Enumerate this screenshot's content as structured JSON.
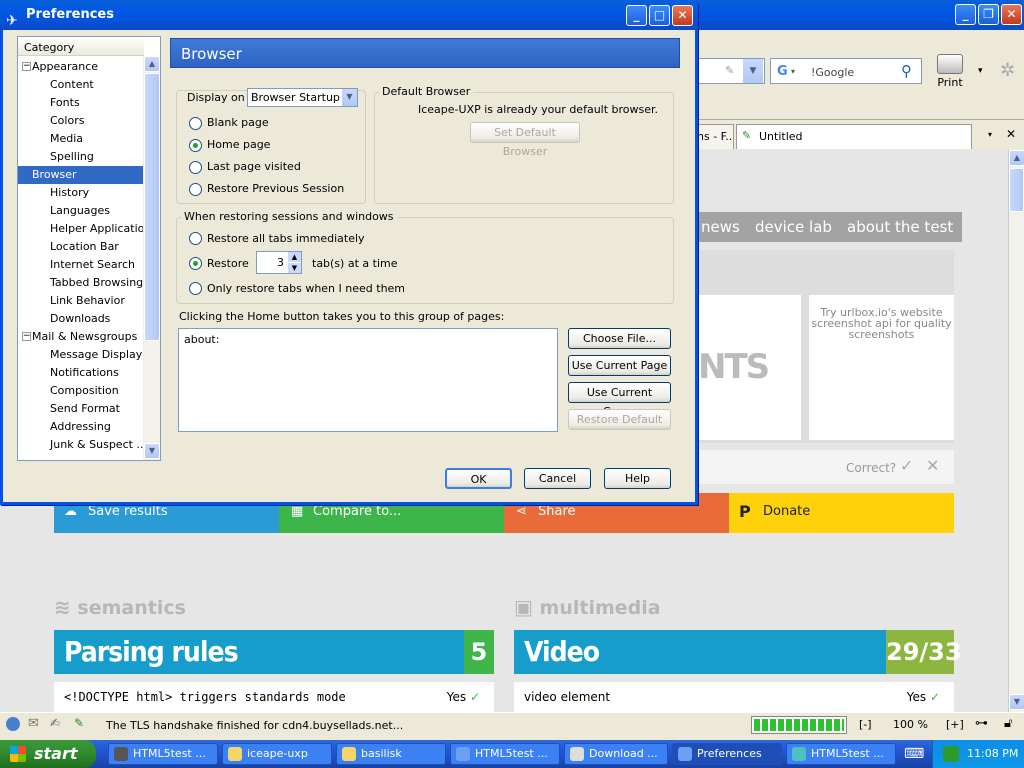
{
  "background_browser": {
    "search": {
      "engine_icon": "G",
      "value": "!Google"
    },
    "print_label": "Print",
    "tabs": [
      "ns - F...",
      "Untitled"
    ],
    "nav_tabs": [
      "news",
      "device lab",
      "about the test"
    ],
    "hero_text": "NTS",
    "ad_text": "Try urlbox.io's website screenshot api for quality screenshots",
    "correct_label": "Correct?",
    "action_buttons": [
      "Save results",
      "Compare to...",
      "Share",
      "Donate"
    ],
    "sections": [
      {
        "name": "semantics",
        "category": "Parsing rules",
        "score": "5",
        "test": "<!DOCTYPE html> triggers standards mode",
        "result": "Yes"
      },
      {
        "name": "multimedia",
        "category": "Video",
        "score": "29/33",
        "test": "video element",
        "result": "Yes"
      }
    ],
    "status_text": "The TLS handshake finished for cdn4.buysellads.net...",
    "progress_fraction": 1.0,
    "zoom_out": "[-]",
    "zoom": "100 %",
    "zoom_in": "[+]"
  },
  "taskbar": {
    "start_label": "start",
    "items": [
      {
        "label": "HTML5test ...",
        "active": false
      },
      {
        "label": "iceape-uxp",
        "active": false
      },
      {
        "label": "basilisk",
        "active": false
      },
      {
        "label": "HTML5test ...",
        "active": false
      },
      {
        "label": "Download ...",
        "active": false
      },
      {
        "label": "Preferences",
        "active": true
      },
      {
        "label": "HTML5test ...",
        "active": false
      }
    ],
    "clock": "11:08 PM"
  },
  "dialog": {
    "title": "Preferences",
    "category_header": "Category",
    "categories": [
      {
        "label": "Appearance",
        "level": 0,
        "expander": "−"
      },
      {
        "label": "Content",
        "level": 1
      },
      {
        "label": "Fonts",
        "level": 1
      },
      {
        "label": "Colors",
        "level": 1
      },
      {
        "label": "Media",
        "level": 1
      },
      {
        "label": "Spelling",
        "level": 1
      },
      {
        "label": "Browser",
        "level": 0,
        "expander": "−",
        "selected": true
      },
      {
        "label": "History",
        "level": 1
      },
      {
        "label": "Languages",
        "level": 1
      },
      {
        "label": "Helper Applicatio...",
        "level": 1
      },
      {
        "label": "Location Bar",
        "level": 1
      },
      {
        "label": "Internet Search",
        "level": 1
      },
      {
        "label": "Tabbed Browsing",
        "level": 1
      },
      {
        "label": "Link Behavior",
        "level": 1
      },
      {
        "label": "Downloads",
        "level": 1
      },
      {
        "label": "Mail & Newsgroups",
        "level": 0,
        "expander": "−"
      },
      {
        "label": "Message Display",
        "level": 1
      },
      {
        "label": "Notifications",
        "level": 1
      },
      {
        "label": "Composition",
        "level": 1
      },
      {
        "label": "Send Format",
        "level": 1
      },
      {
        "label": "Addressing",
        "level": 1
      },
      {
        "label": "Junk & Suspect ...",
        "level": 1
      }
    ],
    "pane_title": "Browser",
    "display_on_label": "Display on",
    "display_on_value": "Browser Startup",
    "startup_options": [
      {
        "label": "Blank page",
        "checked": false
      },
      {
        "label": "Home page",
        "checked": true
      },
      {
        "label": "Last page visited",
        "checked": false
      },
      {
        "label": "Restore Previous Session",
        "checked": false
      }
    ],
    "default_browser": {
      "legend": "Default Browser",
      "message": "Iceape-UXP is already your default browser.",
      "button": "Set Default Browser"
    },
    "restore": {
      "legend": "When restoring sessions and windows",
      "all_label": "Restore all tabs immediately",
      "restore_label": "Restore",
      "tab_count": "3",
      "tab_suffix": "tab(s) at a time",
      "only_label": "Only restore tabs when I need them"
    },
    "home_label": "Clicking the Home button takes you to this group of pages:",
    "home_pages": "about:",
    "home_buttons": [
      "Choose File...",
      "Use Current Page",
      "Use Current Group",
      "Restore Default"
    ],
    "footer": {
      "ok": "OK",
      "cancel": "Cancel",
      "help": "Help"
    }
  }
}
